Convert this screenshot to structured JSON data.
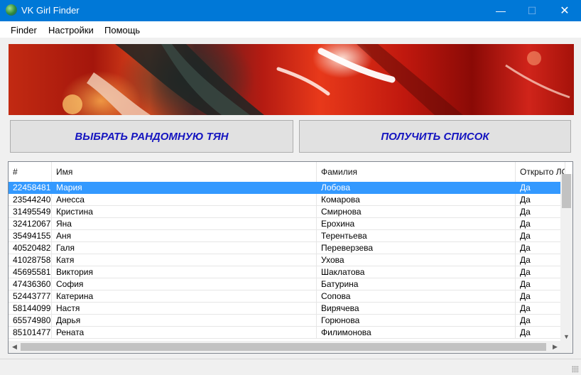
{
  "window": {
    "title": "VK Girl Finder",
    "controls": [
      "—",
      "☐",
      "✕"
    ]
  },
  "menu": [
    {
      "label": "Finder"
    },
    {
      "label": "Настройки"
    },
    {
      "label": "Помощь"
    }
  ],
  "buttons": {
    "random": "ВЫБРАТЬ РАНДОМНУЮ ТЯН",
    "get_list": "ПОЛУЧИТЬ СПИСОК"
  },
  "table": {
    "columns": [
      "#",
      "Имя",
      "Фамилия",
      "Открыто ЛС"
    ],
    "rows": [
      [
        "22458481",
        "Мария",
        "Лобова",
        "Да"
      ],
      [
        "23544240",
        "Анесса",
        "Комарова",
        "Да"
      ],
      [
        "31495549",
        "Кристина",
        "Смирнова",
        "Да"
      ],
      [
        "32412067",
        "Яна",
        "Ерохина",
        "Да"
      ],
      [
        "35494155",
        "Аня",
        "Терентьева",
        "Да"
      ],
      [
        "40520482",
        "Галя",
        "Переверзева",
        "Да"
      ],
      [
        "41028758",
        "Катя",
        "Ухова",
        "Да"
      ],
      [
        "45695581",
        "Виктория",
        "Шаклатова",
        "Да"
      ],
      [
        "47436360",
        "София",
        "Батурина",
        "Да"
      ],
      [
        "52443777",
        "Катерина",
        "Сопова",
        "Да"
      ],
      [
        "58144099",
        "Настя",
        "Вирячева",
        "Да"
      ],
      [
        "65574980",
        "Дарья",
        "Горюнова",
        "Да"
      ],
      [
        "85101477",
        "Рената",
        "Филимонова",
        "Да"
      ]
    ],
    "selected_row": 0
  },
  "colors": {
    "titlebar": "#0078d7",
    "selection": "#3399ff",
    "button_text": "#1515c0"
  }
}
